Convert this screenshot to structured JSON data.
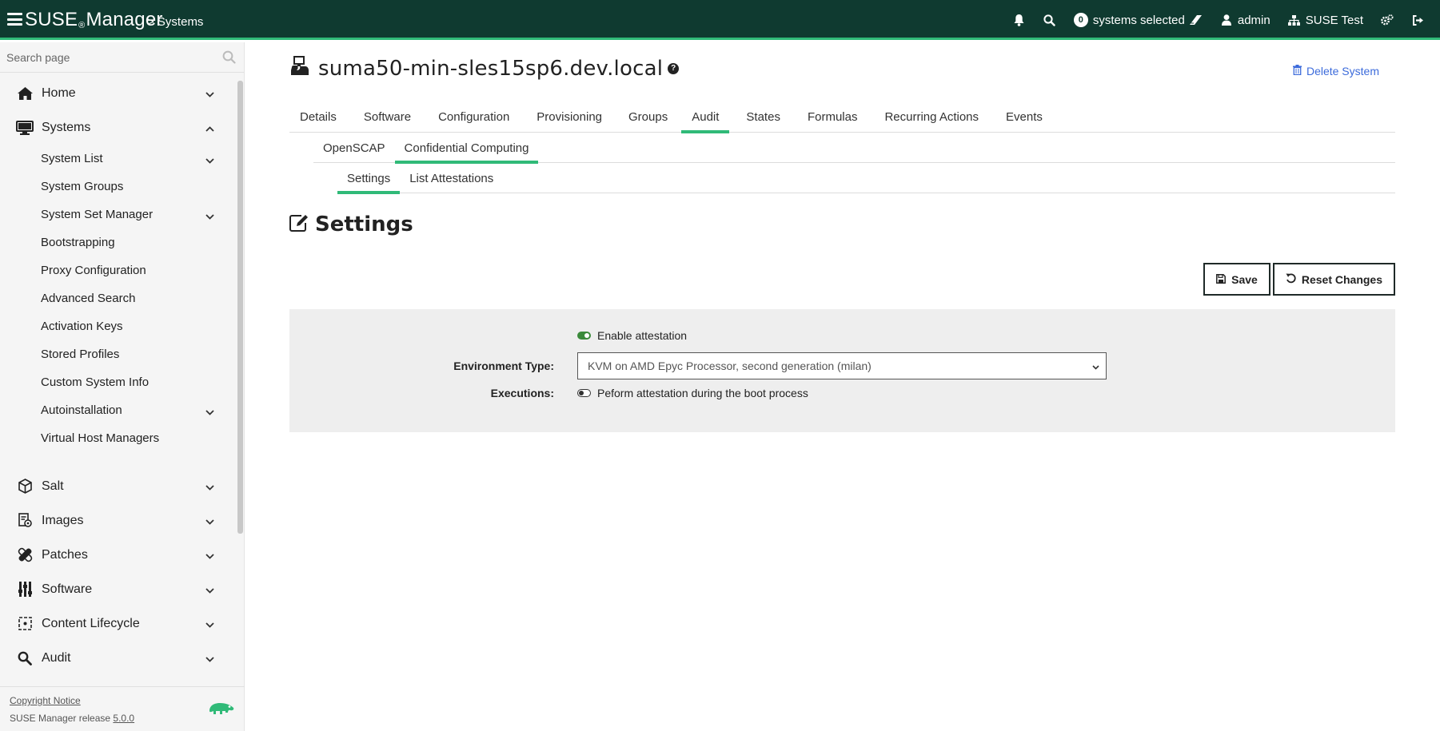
{
  "header": {
    "brand": "SUSE",
    "brand_reg": "®",
    "brand_suffix": "Manager",
    "breadcrumb": "> Systems",
    "systems_selected_count": "0",
    "systems_selected_label": "systems selected",
    "user": "admin",
    "org": "SUSE Test",
    "icons": [
      "bell-icon",
      "search-icon",
      "eraser-icon",
      "user-icon",
      "sitemap-icon",
      "cogs-icon",
      "sign-out-icon"
    ]
  },
  "sidebar": {
    "search_placeholder": "Search page",
    "items": [
      {
        "label": "Home",
        "icon": "home-icon",
        "expanded": false
      },
      {
        "label": "Systems",
        "icon": "desktop-icon",
        "expanded": true
      },
      {
        "label": "Salt",
        "icon": "salt-icon",
        "expanded": false
      },
      {
        "label": "Images",
        "icon": "images-icon",
        "expanded": false
      },
      {
        "label": "Patches",
        "icon": "patches-icon",
        "expanded": false
      },
      {
        "label": "Software",
        "icon": "software-icon",
        "expanded": false
      },
      {
        "label": "Content Lifecycle",
        "icon": "content-lifecycle-icon",
        "expanded": false
      },
      {
        "label": "Audit",
        "icon": "search-icon",
        "expanded": false
      }
    ],
    "systems_sub": [
      {
        "label": "System List",
        "has_children": true
      },
      {
        "label": "System Groups",
        "has_children": false
      },
      {
        "label": "System Set Manager",
        "has_children": true
      },
      {
        "label": "Bootstrapping",
        "has_children": false
      },
      {
        "label": "Proxy Configuration",
        "has_children": false
      },
      {
        "label": "Advanced Search",
        "has_children": false
      },
      {
        "label": "Activation Keys",
        "has_children": false
      },
      {
        "label": "Stored Profiles",
        "has_children": false
      },
      {
        "label": "Custom System Info",
        "has_children": false
      },
      {
        "label": "Autoinstallation",
        "has_children": true
      },
      {
        "label": "Virtual Host Managers",
        "has_children": false
      }
    ],
    "footer": {
      "copyright": "Copyright Notice",
      "release_prefix": "SUSE Manager release ",
      "release_version": "5.0.0"
    }
  },
  "main": {
    "system_name": "suma50-min-sles15sp6.dev.local",
    "delete_label": "Delete System",
    "tabs": [
      "Details",
      "Software",
      "Configuration",
      "Provisioning",
      "Groups",
      "Audit",
      "States",
      "Formulas",
      "Recurring Actions",
      "Events"
    ],
    "active_tab": "Audit",
    "subtabs": [
      "OpenSCAP",
      "Confidential Computing"
    ],
    "active_subtab": "Confidential Computing",
    "subsubtabs": [
      "Settings",
      "List Attestations"
    ],
    "active_subsubtab": "Settings",
    "section_title": "Settings",
    "save_label": "Save",
    "reset_label": "Reset Changes",
    "form": {
      "enable_label": "Enable attestation",
      "enable_value": true,
      "env_type_label": "Environment Type:",
      "env_type_value": "KVM on AMD Epyc Processor, second generation (milan)",
      "executions_label": "Executions:",
      "executions_text": "Peform attestation during the boot process",
      "executions_value": false
    }
  },
  "colors": {
    "header_bg": "#0f3a30",
    "accent": "#30ba78",
    "link": "#3c6bdb",
    "panel_bg": "#eeeeee"
  }
}
